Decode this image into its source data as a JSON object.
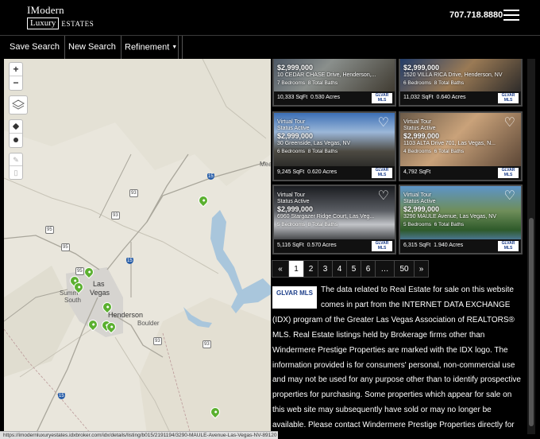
{
  "header": {
    "logo_line1": "IModern",
    "logo_luxury": "Luxury",
    "logo_estates": "ESTATES",
    "phone": "707.718.8880",
    "menu_icon": "hamburger-icon"
  },
  "toolbar": {
    "save_search": "Save Search",
    "new_search": "New Search",
    "refinement": "Refinement"
  },
  "map": {
    "zoom_in": "+",
    "zoom_out": "−",
    "labels": {
      "las_vegas_1": "Las",
      "las_vegas_2": "Vegas",
      "henderson": "Henderson",
      "boulder": "Boulder",
      "summerlin_1": "Summ",
      "summerlin_2": "South",
      "mead": "Meado"
    },
    "routes": {
      "i15_top": "15",
      "i15_mid": "15",
      "i15_bottom": "15",
      "us93_a": "93",
      "us93_b": "93",
      "us93_c": "93",
      "sr95_a": "95",
      "sr95_b": "95",
      "sr95_c": "95",
      "sr93_d": "93"
    },
    "pin_count": 9,
    "colors": {
      "water": "#a9c6dc",
      "pin": "#5bb030"
    }
  },
  "listings": [
    {
      "virtual_tour": "",
      "status": "",
      "price": "$2,999,000",
      "address": "10 CEDAR CHASE Drive, Henderson,...",
      "beds": "7 Bedrooms",
      "baths": "8 Total Baths",
      "sqft": "10,333 SqFt",
      "acres": "0.530 Acres",
      "mls_badge": "GLVAR MLS"
    },
    {
      "virtual_tour": "",
      "status": "",
      "price": "$2,999,000",
      "address": "1520 VILLA RICA Drive, Henderson, NV",
      "beds": "6 Bedrooms",
      "baths": "8 Total Baths",
      "sqft": "11,032 SqFt",
      "acres": "0.640 Acres",
      "mls_badge": "GLVAR MLS"
    },
    {
      "virtual_tour": "Virtual Tour",
      "status": "Status Active",
      "price": "$2,999,000",
      "address": "30 Greenside, Las Vegas, NV",
      "beds": "6 Bedrooms",
      "baths": "8 Total Baths",
      "sqft": "9,245 SqFt",
      "acres": "0.620 Acres",
      "mls_badge": "GLVAR MLS"
    },
    {
      "virtual_tour": "Virtual Tour",
      "status": "Status Active",
      "price": "$2,999,000",
      "address": "1103 ALTA Drive 701, Las Vegas, N...",
      "beds": "4 Bedrooms",
      "baths": "6 Total Baths",
      "sqft": "4,792 SqFt",
      "acres": "",
      "mls_badge": "GLVAR MLS"
    },
    {
      "virtual_tour": "Virtual Tour",
      "status": "Status Active",
      "price": "$2,999,000",
      "address": "6960 Stargazer Ridge Court, Las Veg...",
      "beds": "5 Bedrooms",
      "baths": "8 Total Baths",
      "sqft": "5,116 SqFt",
      "acres": "0.570 Acres",
      "mls_badge": "GLVAR MLS"
    },
    {
      "virtual_tour": "Virtual Tour",
      "status": "Status Active",
      "price": "$2,999,000",
      "address": "3290 MAULE Avenue, Las Vegas, NV",
      "beds": "5 Bedrooms",
      "baths": "6 Total Baths",
      "sqft": "6,315 SqFt",
      "acres": "1.940 Acres",
      "mls_badge": "GLVAR MLS"
    }
  ],
  "pagination": {
    "prev": "«",
    "pages": [
      "1",
      "2",
      "3",
      "4",
      "5",
      "6",
      "…",
      "50"
    ],
    "next": "»",
    "current": "1"
  },
  "disclaimer": {
    "logo": "GLVAR MLS",
    "text": "The data related to Real Estate for sale on this website comes in part from the INTERNET DATA EXCHANGE (IDX) program of the Greater Las Vegas Association of REALTORS® MLS. Real Estate listings held by Brokerage firms other than Windermere Prestige Properties are marked with the IDX logo. The information provided is for consumers' personal, non-commercial use and may not be used for any purpose other than to identify prospective properties for purchasing. Some properties which appear for sale on this web site may subsequently have sold or may no longer be available. Please contact Windermere Prestige Properties directly for additional information pertaining to the status and availability of properties displayed on this website."
  },
  "status_bar": "https://imodernluxuryestates.idxbroker.com/idx/details/listing/b015/2191194/3290-MAULE-Avenue-Las-Vegas-NV-89120"
}
